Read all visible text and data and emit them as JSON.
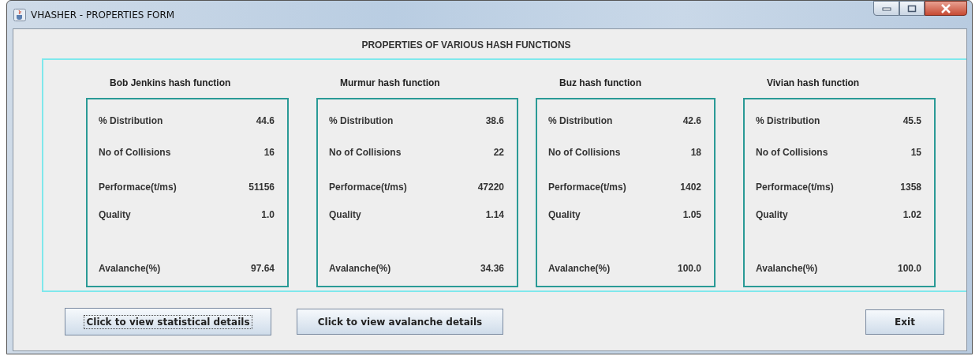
{
  "window": {
    "title": "VHASHER - PROPERTIES FORM"
  },
  "heading": "PROPERTIES OF VARIOUS HASH FUNCTIONS",
  "functions": [
    {
      "name": "Bob Jenkins hash function",
      "rows": [
        {
          "label": "% Distribution",
          "value": "44.6"
        },
        {
          "label": "No of Collisions",
          "value": "16"
        },
        {
          "label": "Performace(t/ms)",
          "value": "51156"
        },
        {
          "label": "Quality",
          "value": "1.0"
        },
        {
          "label": "Avalanche(%)",
          "value": "97.64"
        }
      ]
    },
    {
      "name": "Murmur hash function",
      "rows": [
        {
          "label": "% Distribution",
          "value": "38.6"
        },
        {
          "label": "No of Collisions",
          "value": "22"
        },
        {
          "label": "Performace(t/ms)",
          "value": "47220"
        },
        {
          "label": "Quality",
          "value": "1.14"
        },
        {
          "label": "Avalanche(%)",
          "value": "34.36"
        }
      ]
    },
    {
      "name": "Buz hash function",
      "rows": [
        {
          "label": "% Distribution",
          "value": "42.6"
        },
        {
          "label": "No of Collisions",
          "value": "18"
        },
        {
          "label": "Performace(t/ms)",
          "value": "1402"
        },
        {
          "label": "Quality",
          "value": "1.05"
        },
        {
          "label": "Avalanche(%)",
          "value": "100.0"
        }
      ]
    },
    {
      "name": "Vivian hash function",
      "rows": [
        {
          "label": "% Distribution",
          "value": "45.5"
        },
        {
          "label": "No of Collisions",
          "value": "15"
        },
        {
          "label": "Performace(t/ms)",
          "value": "1358"
        },
        {
          "label": "Quality",
          "value": "1.02"
        },
        {
          "label": "Avalanche(%)",
          "value": "100.0"
        }
      ]
    }
  ],
  "buttons": [
    {
      "label": "Click to view statistical details",
      "focused": true
    },
    {
      "label": "Click to view avalanche details",
      "focused": false
    },
    {
      "label": "Exit",
      "focused": false
    }
  ]
}
